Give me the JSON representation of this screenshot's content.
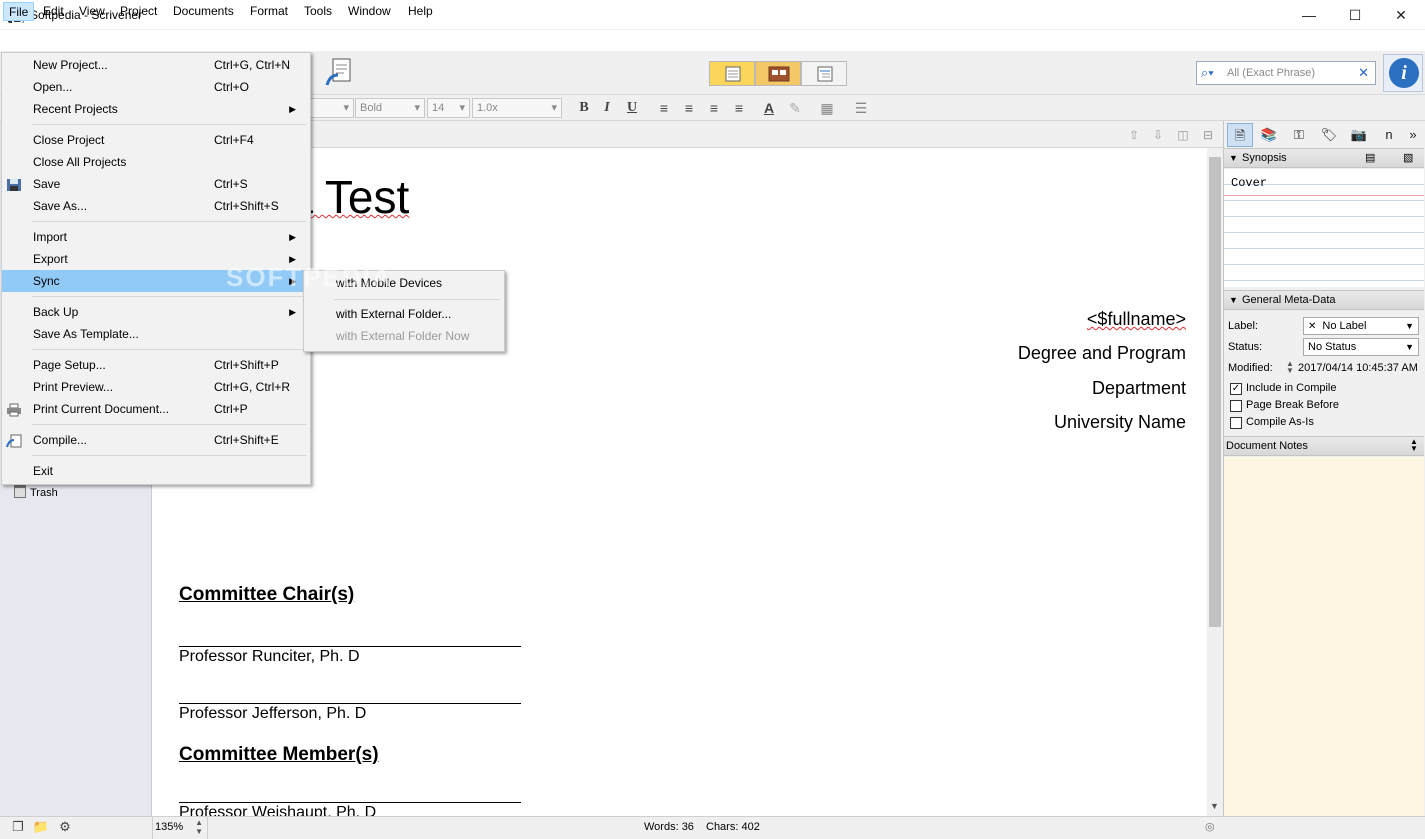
{
  "window": {
    "title": "Softpedia - Scrivener",
    "minimize_icon": "minimize-icon",
    "maximize_icon": "maximize-icon",
    "close_icon": "close-icon"
  },
  "menubar": [
    "File",
    "Edit",
    "View",
    "Project",
    "Documents",
    "Format",
    "Tools",
    "Window",
    "Help"
  ],
  "file_menu": {
    "items": [
      {
        "label": "New Project...",
        "shortcut": "Ctrl+G, Ctrl+N"
      },
      {
        "label": "Open...",
        "shortcut": "Ctrl+O"
      },
      {
        "label": "Recent Projects",
        "shortcut": ""
      },
      {
        "label": "Close Project",
        "shortcut": "Ctrl+F4"
      },
      {
        "label": "Close All Projects",
        "shortcut": ""
      },
      {
        "label": "Save",
        "shortcut": "Ctrl+S"
      },
      {
        "label": "Save As...",
        "shortcut": "Ctrl+Shift+S"
      },
      {
        "label": "Import",
        "shortcut": ""
      },
      {
        "label": "Export",
        "shortcut": ""
      },
      {
        "label": "Sync",
        "shortcut": ""
      },
      {
        "label": "Back Up",
        "shortcut": ""
      },
      {
        "label": "Save As Template...",
        "shortcut": ""
      },
      {
        "label": "Page Setup...",
        "shortcut": "Ctrl+Shift+P"
      },
      {
        "label": "Print Preview...",
        "shortcut": "Ctrl+G, Ctrl+R"
      },
      {
        "label": "Print Current Document...",
        "shortcut": "Ctrl+P"
      },
      {
        "label": "Compile...",
        "shortcut": "Ctrl+Shift+E"
      },
      {
        "label": "Exit",
        "shortcut": ""
      }
    ]
  },
  "sync_menu": {
    "items": [
      "with Mobile Devices",
      "with External Folder...",
      "with External Folder Now"
    ]
  },
  "watermark": "SOFTPEDIA",
  "toolbar": {
    "search_placeholder": "All (Exact Phrase)",
    "search_clear": "✕",
    "info_label": "i"
  },
  "formatbar": {
    "font_style": "Bold",
    "font_size": "14",
    "line_spacing": "1.0x",
    "bold": "B",
    "italic": "I",
    "underline": "U"
  },
  "binder": {
    "trash_label": "Trash"
  },
  "document": {
    "title_visible": "edia Test",
    "right_lines": [
      "<$fullname>",
      "Degree and Program",
      "Department",
      "University Name"
    ],
    "chair_heading": "Committee Chair(s)",
    "professors_chair": [
      "Professor Runciter, Ph. D",
      "Professor Jefferson, Ph. D"
    ],
    "member_heading": "Committee Member(s)",
    "professor_member": "Professor Weishaupt, Ph. D"
  },
  "inspector": {
    "synopsis_header": "Synopsis",
    "synopsis_text": "Cover",
    "meta_header": "General Meta-Data",
    "label_label": "Label:",
    "label_value": "No Label",
    "status_label": "Status:",
    "status_value": "No Status",
    "modified_label": "Modified:",
    "modified_value": "2017/04/14 10:45:37 AM",
    "checkboxes": [
      {
        "label": "Include in Compile",
        "checked": true
      },
      {
        "label": "Page Break Before",
        "checked": false
      },
      {
        "label": "Compile As-Is",
        "checked": false
      }
    ],
    "notes_header": "Document Notes"
  },
  "statusbar": {
    "zoom": "135%",
    "words": "Words: 36",
    "chars": "Chars: 402"
  },
  "colors": {
    "menu_highlight": "#91c9f7",
    "file_menu_active": "#cce8ff",
    "notes_background": "#fcf6e2",
    "spelling_underline": "#e03030"
  }
}
